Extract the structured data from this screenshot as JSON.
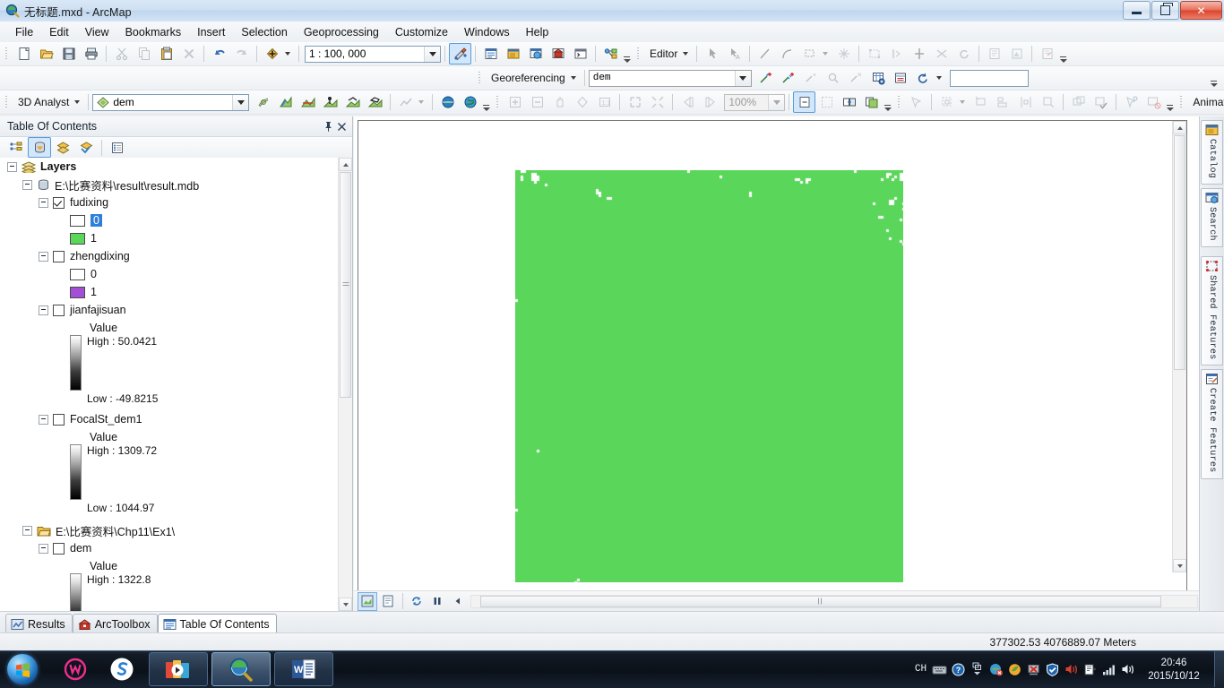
{
  "window": {
    "title": "无标题.mxd - ArcMap",
    "app_icon": "arcmap-icon",
    "minimize_label": "Minimize",
    "restore_label": "Restore",
    "close_label": "Close"
  },
  "menubar": {
    "items": [
      {
        "label": "File"
      },
      {
        "label": "Edit"
      },
      {
        "label": "View"
      },
      {
        "label": "Bookmarks"
      },
      {
        "label": "Insert"
      },
      {
        "label": "Selection"
      },
      {
        "label": "Geoprocessing"
      },
      {
        "label": "Customize"
      },
      {
        "label": "Windows"
      },
      {
        "label": "Help"
      }
    ]
  },
  "standard_toolbar": {
    "scale_value": "1 : 100, 000",
    "buttons": [
      {
        "name": "new-map-icon",
        "enabled": true
      },
      {
        "name": "open-icon",
        "enabled": true
      },
      {
        "name": "save-icon",
        "enabled": true
      },
      {
        "name": "print-icon",
        "enabled": true
      },
      {
        "name": "cut-icon",
        "enabled": false
      },
      {
        "name": "copy-icon",
        "enabled": false
      },
      {
        "name": "paste-icon",
        "enabled": true
      },
      {
        "name": "delete-icon",
        "enabled": false
      },
      {
        "name": "undo-icon",
        "enabled": true
      },
      {
        "name": "redo-icon",
        "enabled": false
      },
      {
        "name": "add-data-icon",
        "enabled": true
      },
      {
        "name": "editor-toolbar-icon",
        "enabled": true
      },
      {
        "name": "table-of-contents-icon",
        "enabled": true
      },
      {
        "name": "catalog-window-icon",
        "enabled": true
      },
      {
        "name": "search-window-icon",
        "enabled": true
      },
      {
        "name": "arctoolbox-icon",
        "enabled": true
      },
      {
        "name": "python-window-icon",
        "enabled": true
      },
      {
        "name": "model-builder-icon",
        "enabled": true
      }
    ]
  },
  "editor_toolbar": {
    "menu_label": "Editor",
    "buttons": [
      {
        "name": "edit-tool-icon",
        "enabled": false
      },
      {
        "name": "edit-annotation-icon",
        "enabled": false
      },
      {
        "name": "straight-segment-icon",
        "enabled": false
      },
      {
        "name": "arc-segment-icon",
        "enabled": false
      },
      {
        "name": "trace-icon",
        "enabled": false
      },
      {
        "name": "sketch-properties-icon",
        "enabled": false
      },
      {
        "name": "edit-vertices-icon",
        "enabled": false
      },
      {
        "name": "reshape-icon",
        "enabled": false
      },
      {
        "name": "split-icon",
        "enabled": false
      },
      {
        "name": "cut-polygons-icon",
        "enabled": false
      },
      {
        "name": "rotate-icon",
        "enabled": false
      },
      {
        "name": "attributes-icon",
        "enabled": false
      },
      {
        "name": "sketch-icon",
        "enabled": false
      },
      {
        "name": "create-features-icon",
        "enabled": false
      }
    ]
  },
  "georeferencing_toolbar": {
    "menu_label": "Georeferencing",
    "layer_value": "dem",
    "text_value": "",
    "buttons": [
      {
        "name": "add-control-points-icon",
        "enabled": true
      },
      {
        "name": "auto-registration-icon",
        "enabled": true
      },
      {
        "name": "select-link-icon",
        "enabled": false
      },
      {
        "name": "zoom-to-link-icon",
        "enabled": false
      },
      {
        "name": "delete-link-icon",
        "enabled": false
      },
      {
        "name": "view-link-table-icon",
        "enabled": true
      },
      {
        "name": "link-table-icon",
        "enabled": true
      },
      {
        "name": "rotate-raster-icon",
        "enabled": true
      }
    ]
  },
  "analyst_toolbar": {
    "menu_label": "3D Analyst",
    "layer_value": "dem",
    "zoom_value": "100%",
    "animation_label": "Animation",
    "buttons": [
      {
        "name": "contour-icon",
        "enabled": true
      },
      {
        "name": "steepest-path-icon",
        "enabled": true
      },
      {
        "name": "line-of-sight-icon",
        "enabled": true
      },
      {
        "name": "interpolate-point-icon",
        "enabled": true
      },
      {
        "name": "interpolate-line-icon",
        "enabled": true
      },
      {
        "name": "interpolate-polygon-icon",
        "enabled": true
      },
      {
        "name": "profile-graph-icon",
        "enabled": false
      },
      {
        "name": "arcscene-icon",
        "enabled": true
      },
      {
        "name": "arcglobe-icon",
        "enabled": true
      },
      {
        "name": "zoom-in-icon",
        "enabled": false
      },
      {
        "name": "zoom-out-icon",
        "enabled": false
      },
      {
        "name": "pan-icon",
        "enabled": false
      },
      {
        "name": "full-extent-icon",
        "enabled": false
      },
      {
        "name": "one-to-one-icon",
        "enabled": false
      },
      {
        "name": "fixed-zoom-in-icon",
        "enabled": false
      },
      {
        "name": "fixed-zoom-out-icon",
        "enabled": false
      },
      {
        "name": "go-back-icon",
        "enabled": false
      },
      {
        "name": "go-forward-icon",
        "enabled": false
      },
      {
        "name": "page-icon",
        "enabled": true
      },
      {
        "name": "layout-icon",
        "enabled": false
      },
      {
        "name": "change-layout-icon",
        "enabled": true
      },
      {
        "name": "data-driven-pages-icon",
        "enabled": true
      },
      {
        "name": "snapshot-icon",
        "enabled": true
      }
    ]
  },
  "toc": {
    "title": "Table Of Contents",
    "pin_icon": "pin-icon",
    "close_icon": "close-icon",
    "tool_buttons": [
      {
        "name": "list-by-drawing-order-icon",
        "active": false
      },
      {
        "name": "list-by-source-icon",
        "active": true
      },
      {
        "name": "list-by-visibility-icon",
        "active": false
      },
      {
        "name": "list-by-selection-icon",
        "active": false
      },
      {
        "name": "options-icon",
        "active": false
      }
    ],
    "tree": {
      "root_label": "Layers",
      "groups": [
        {
          "label": "E:\\比赛资料\\result\\result.mdb",
          "icon": "geodatabase-icon",
          "layers": [
            {
              "label": "fudixing",
              "checked": true,
              "type": "classified",
              "classes": [
                {
                  "label": "0",
                  "color": "#ffffff",
                  "selected": true
                },
                {
                  "label": "1",
                  "color": "#5ad65a",
                  "selected": false
                }
              ]
            },
            {
              "label": "zhengdixing",
              "checked": false,
              "type": "classified",
              "classes": [
                {
                  "label": "0",
                  "color": "#ffffff",
                  "selected": false
                },
                {
                  "label": "1",
                  "color": "#a24fd6",
                  "selected": false
                }
              ]
            },
            {
              "label": "jianfajisuan",
              "checked": false,
              "type": "stretched",
              "value_label": "Value",
              "high_label": "High : 50.0421",
              "low_label": "Low : -49.8215"
            },
            {
              "label": "FocalSt_dem1",
              "checked": false,
              "type": "stretched",
              "value_label": "Value",
              "high_label": "High : 1309.72",
              "low_label": "Low : 1044.97"
            }
          ]
        },
        {
          "label": "E:\\比赛资料\\Chp11\\Ex1\\",
          "icon": "folder-icon",
          "layers": [
            {
              "label": "dem",
              "checked": false,
              "type": "stretched",
              "value_label": "Value",
              "high_label": "High : 1322.8",
              "low_label": ""
            }
          ]
        }
      ]
    }
  },
  "map": {
    "layer_color": "#5ad65a",
    "background": "#ffffff",
    "border_color": "#7a7a7a"
  },
  "right_dock": {
    "tabs": [
      {
        "label": "Catalog",
        "icon": "catalog-icon"
      },
      {
        "label": "Search",
        "icon": "search-icon"
      },
      {
        "label": "Shared Features",
        "icon": "shared-features-icon"
      },
      {
        "label": "Create Features",
        "icon": "create-features-icon"
      }
    ]
  },
  "bottom_tabs": [
    {
      "label": "Results",
      "icon": "results-icon",
      "active": false
    },
    {
      "label": "ArcToolbox",
      "icon": "arctoolbox-icon",
      "active": false
    },
    {
      "label": "Table Of Contents",
      "icon": "toc-icon",
      "active": true
    }
  ],
  "view_buttons": [
    {
      "name": "data-view-icon",
      "active": true
    },
    {
      "name": "layout-view-icon",
      "active": false
    },
    {
      "name": "refresh-icon",
      "active": false
    },
    {
      "name": "pause-drawing-icon",
      "active": false
    },
    {
      "name": "previous-extent-icon",
      "active": false
    }
  ],
  "status": {
    "coordinates": "377302.53  4076889.07 Meters"
  },
  "taskbar": {
    "start_label": "Start",
    "quick_items": [
      {
        "name": "pink-w-app-icon"
      },
      {
        "name": "blue-s-app-icon"
      }
    ],
    "running": [
      {
        "name": "media-player-task",
        "active": false
      },
      {
        "name": "arcmap-task",
        "active": true
      },
      {
        "name": "word-task",
        "active": false
      }
    ],
    "tray": [
      {
        "name": "ime-indicator",
        "label": "CH"
      },
      {
        "name": "keyboard-icon",
        "label": ""
      },
      {
        "name": "help-icon",
        "label": ""
      },
      {
        "name": "show-hidden-icons",
        "label": ""
      },
      {
        "name": "browser-icon",
        "label": ""
      },
      {
        "name": "green-shield-icon",
        "label": ""
      },
      {
        "name": "red-x-icon",
        "label": ""
      },
      {
        "name": "security-shield-icon",
        "label": ""
      },
      {
        "name": "volume-mute-icon",
        "label": ""
      },
      {
        "name": "network-plug-icon",
        "label": ""
      },
      {
        "name": "signal-bars-icon",
        "label": ""
      },
      {
        "name": "speaker-icon",
        "label": ""
      }
    ],
    "clock_time": "20:46",
    "clock_date": "2015/10/12"
  }
}
